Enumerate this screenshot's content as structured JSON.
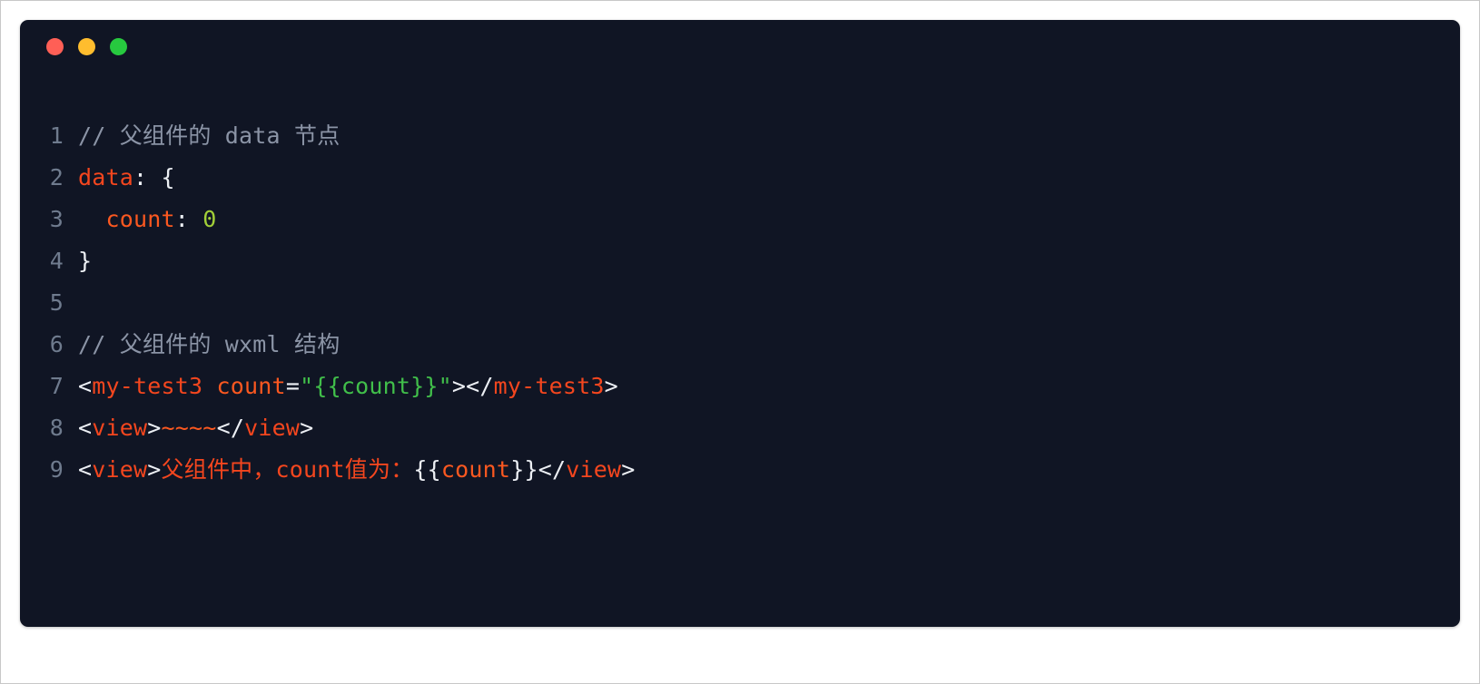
{
  "window": {
    "traffic_lights": [
      {
        "name": "close",
        "color": "#ff5f56"
      },
      {
        "name": "minimize",
        "color": "#ffbd2e"
      },
      {
        "name": "maximize",
        "color": "#27c93f"
      }
    ]
  },
  "editor": {
    "language": "wxml",
    "theme_background": "#101524",
    "line_number_color": "#6f7b8e",
    "lines": [
      {
        "number": "1",
        "plain": "// 父组件的 data 节点",
        "tokens": [
          {
            "t": "// 父组件的 data 节点",
            "c": "tok-comment"
          }
        ]
      },
      {
        "number": "2",
        "plain": "data: {",
        "tokens": [
          {
            "t": "data",
            "c": "tok-kw"
          },
          {
            "t": ": {",
            "c": "tok-punc"
          }
        ]
      },
      {
        "number": "3",
        "plain": "  count: 0",
        "tokens": [
          {
            "t": "  ",
            "c": "tok-plain"
          },
          {
            "t": "count",
            "c": "tok-prop"
          },
          {
            "t": ": ",
            "c": "tok-punc"
          },
          {
            "t": "0",
            "c": "tok-num"
          }
        ]
      },
      {
        "number": "4",
        "plain": "}",
        "tokens": [
          {
            "t": "}",
            "c": "tok-punc"
          }
        ]
      },
      {
        "number": "5",
        "plain": "",
        "tokens": []
      },
      {
        "number": "6",
        "plain": "// 父组件的 wxml 结构",
        "tokens": [
          {
            "t": "// 父组件的 wxml 结构",
            "c": "tok-comment"
          }
        ]
      },
      {
        "number": "7",
        "plain": "<my-test3 count=\"{{count}}\"></my-test3>",
        "tokens": [
          {
            "t": "<",
            "c": "tok-punc"
          },
          {
            "t": "my-test3",
            "c": "tok-tag"
          },
          {
            "t": " ",
            "c": "tok-plain"
          },
          {
            "t": "count",
            "c": "tok-prop"
          },
          {
            "t": "=",
            "c": "tok-punc"
          },
          {
            "t": "\"{{count}}\"",
            "c": "tok-str"
          },
          {
            "t": "></",
            "c": "tok-punc"
          },
          {
            "t": "my-test3",
            "c": "tok-tag"
          },
          {
            "t": ">",
            "c": "tok-punc"
          }
        ]
      },
      {
        "number": "8",
        "plain": "<view>~~~~</view>",
        "tokens": [
          {
            "t": "<",
            "c": "tok-punc"
          },
          {
            "t": "view",
            "c": "tok-tag"
          },
          {
            "t": ">",
            "c": "tok-punc"
          },
          {
            "t": "~~~~",
            "c": "tok-tilde"
          },
          {
            "t": "</",
            "c": "tok-punc"
          },
          {
            "t": "view",
            "c": "tok-tag"
          },
          {
            "t": ">",
            "c": "tok-punc"
          }
        ]
      },
      {
        "number": "9",
        "plain": "<view>父组件中，count值为：{{count}}</view>",
        "tokens": [
          {
            "t": "<",
            "c": "tok-punc"
          },
          {
            "t": "view",
            "c": "tok-tag"
          },
          {
            "t": ">",
            "c": "tok-punc"
          },
          {
            "t": "父组件中，count值为：",
            "c": "tok-text"
          },
          {
            "t": "{{",
            "c": "tok-punc"
          },
          {
            "t": "count",
            "c": "tok-prop"
          },
          {
            "t": "}}",
            "c": "tok-punc"
          },
          {
            "t": "</",
            "c": "tok-punc"
          },
          {
            "t": "view",
            "c": "tok-tag"
          },
          {
            "t": ">",
            "c": "tok-punc"
          }
        ]
      }
    ]
  }
}
